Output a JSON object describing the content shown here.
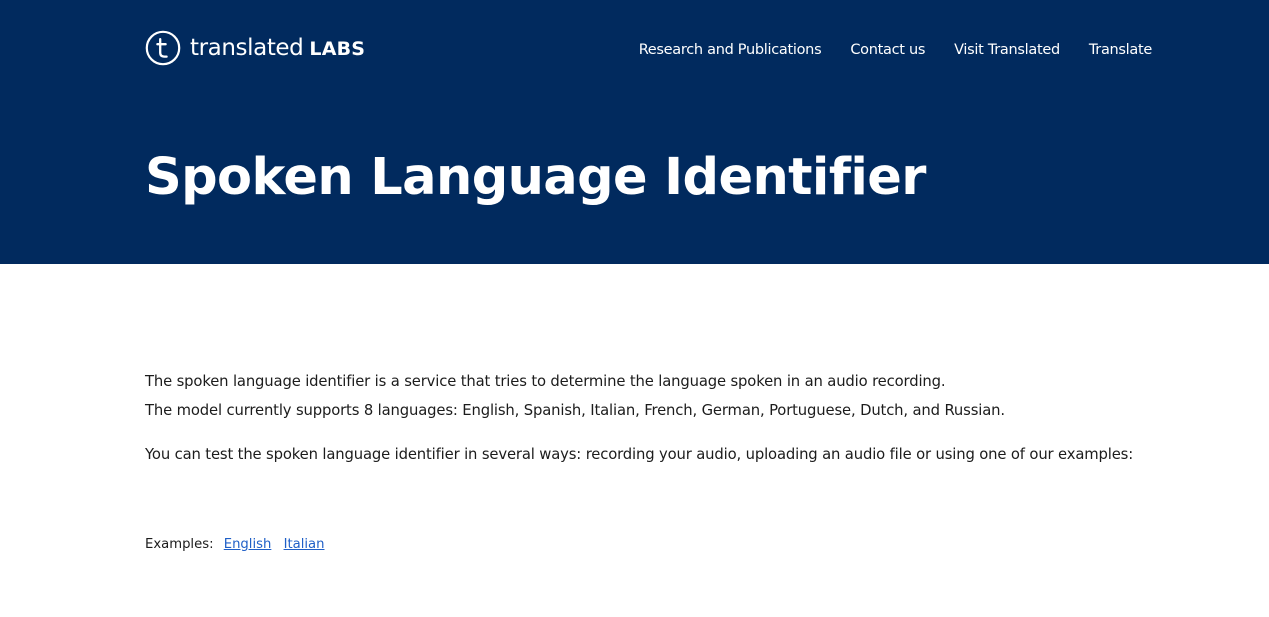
{
  "header": {
    "logo": {
      "icon": "translated-t-circle-logo",
      "wordmark": "translated",
      "suffix": "LABS"
    },
    "nav": [
      {
        "label": "Research and Publications"
      },
      {
        "label": "Contact us"
      },
      {
        "label": "Visit Translated"
      },
      {
        "label": "Translate"
      }
    ],
    "background_color": "#012a5e"
  },
  "page": {
    "title": "Spoken Language Identifier"
  },
  "content": {
    "intro_line_1": "The spoken language identifier is a service that tries to determine the language spoken in an audio recording.",
    "intro_line_2": "The model currently supports 8 languages: English, Spanish, Italian, French, German, Portuguese, Dutch, and Russian.",
    "ways": "You can test the spoken language identifier in several ways: recording your audio, uploading an audio file or using one of our examples:",
    "examples_label": "Examples:",
    "examples": [
      {
        "label": "English"
      },
      {
        "label": "Italian"
      }
    ],
    "link_color": "#1f5fc7"
  }
}
